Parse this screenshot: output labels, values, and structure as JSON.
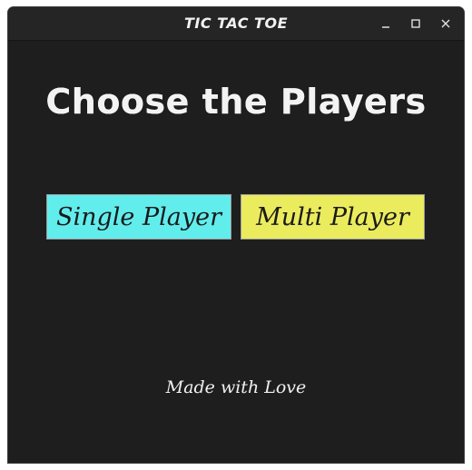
{
  "window": {
    "title": "TIC TAC TOE",
    "controls": {
      "minimize_icon": "minimize-icon",
      "maximize_icon": "maximize-icon",
      "close_icon": "close-icon"
    }
  },
  "main": {
    "heading": "Choose the Players",
    "buttons": {
      "single": {
        "label": "Single Player",
        "color": "#62eded"
      },
      "multi": {
        "label": "Multi Player",
        "color": "#ebeb5e"
      }
    },
    "footer": "Made with Love"
  },
  "theme": {
    "background": "#1e1e1e",
    "text": "#f3f3f3"
  }
}
